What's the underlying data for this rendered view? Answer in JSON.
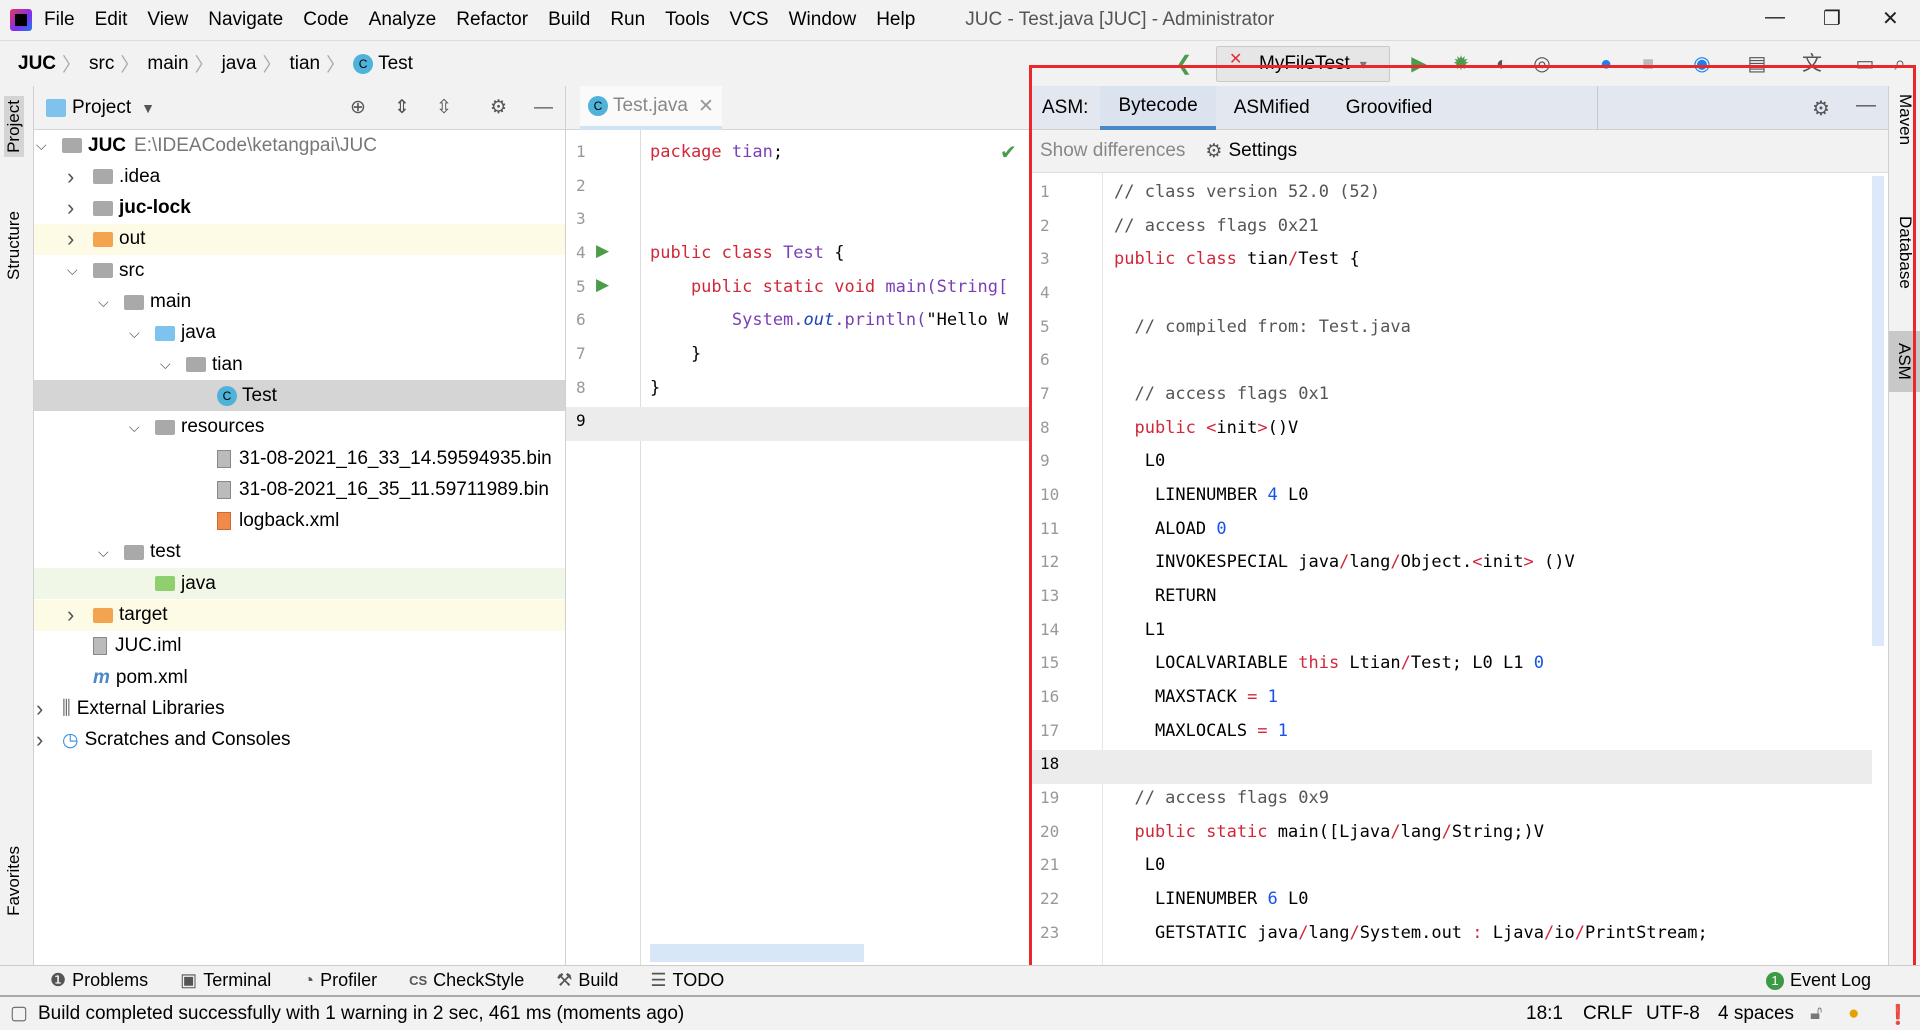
{
  "menu": {
    "items": [
      "File",
      "Edit",
      "View",
      "Navigate",
      "Code",
      "Analyze",
      "Refactor",
      "Build",
      "Run",
      "Tools",
      "VCS",
      "Window",
      "Help"
    ],
    "window_title": "JUC - Test.java [JUC] - Administrator"
  },
  "breadcrumb": [
    "JUC",
    "src",
    "main",
    "java",
    "tian",
    "Test"
  ],
  "toolbar": {
    "run_config": "MyFileTest"
  },
  "left_strip": {
    "project": "Project",
    "structure": "Structure",
    "favorites": "Favorites"
  },
  "right_strip": {
    "maven": "Maven",
    "database": "Database",
    "asm": "ASM"
  },
  "project": {
    "title": "Project",
    "tree": [
      {
        "label": "JUC",
        "extra": "E:\\IDEACode\\ketangpai\\JUC",
        "depth": 0,
        "expanded": true,
        "icon": "module-folder",
        "bold": true
      },
      {
        "label": ".idea",
        "depth": 1,
        "expanded": false,
        "icon": "folder"
      },
      {
        "label": "juc-lock",
        "depth": 1,
        "expanded": false,
        "icon": "module-folder",
        "bold": true
      },
      {
        "label": "out",
        "depth": 1,
        "expanded": false,
        "icon": "folder-orange",
        "highlight": "#fdfbe6"
      },
      {
        "label": "src",
        "depth": 1,
        "expanded": true,
        "icon": "folder"
      },
      {
        "label": "main",
        "depth": 2,
        "expanded": true,
        "icon": "folder"
      },
      {
        "label": "java",
        "depth": 3,
        "expanded": true,
        "icon": "folder-blue"
      },
      {
        "label": "tian",
        "depth": 4,
        "expanded": true,
        "icon": "package"
      },
      {
        "label": "Test",
        "depth": 5,
        "icon": "java-class",
        "selected": true
      },
      {
        "label": "resources",
        "depth": 3,
        "expanded": true,
        "icon": "resources-folder"
      },
      {
        "label": "31-08-2021_16_33_14.59594935.bin",
        "depth": 5,
        "icon": "file"
      },
      {
        "label": "31-08-2021_16_35_11.59711989.bin",
        "depth": 5,
        "icon": "file"
      },
      {
        "label": "logback.xml",
        "depth": 5,
        "icon": "xml-file"
      },
      {
        "label": "test",
        "depth": 2,
        "expanded": true,
        "icon": "folder"
      },
      {
        "label": "java",
        "depth": 3,
        "icon": "folder-green",
        "highlight": "#f0f7e6"
      },
      {
        "label": "target",
        "depth": 1,
        "expanded": false,
        "icon": "folder-orange",
        "highlight": "#fdfbe6"
      },
      {
        "label": "JUC.iml",
        "depth": 1,
        "icon": "iml-file"
      },
      {
        "label": "pom.xml",
        "depth": 1,
        "icon": "maven-file"
      },
      {
        "label": "External Libraries",
        "depth": 0,
        "expanded": false,
        "icon": "libraries"
      },
      {
        "label": "Scratches and Consoles",
        "depth": 0,
        "expanded": false,
        "icon": "scratches"
      }
    ]
  },
  "editor": {
    "tab": "Test.java",
    "lines": [
      [
        [
          "package ",
          "kw"
        ],
        [
          "tian",
          "id"
        ],
        [
          ";",
          ""
        ]
      ],
      [],
      [],
      [
        [
          "public class ",
          "kw"
        ],
        [
          "Test",
          "id"
        ],
        [
          " {",
          ""
        ]
      ],
      [
        [
          "    public static void ",
          "kw"
        ],
        [
          "main(String[",
          "id"
        ]
      ],
      [
        [
          "        System.",
          "id"
        ],
        [
          "out",
          "it"
        ],
        [
          ".println(",
          "id"
        ],
        [
          "\"Hello W",
          ""
        ]
      ],
      [
        [
          "    }",
          ""
        ]
      ],
      [
        [
          "}",
          ""
        ]
      ],
      []
    ],
    "run_lines": [
      4,
      5
    ],
    "current_line": 9
  },
  "asm": {
    "label": "ASM:",
    "tabs": [
      "Bytecode",
      "ASMified",
      "Groovified"
    ],
    "active_tab": "Bytecode",
    "show_differences": "Show differences",
    "settings": "Settings",
    "current_line": 18,
    "lines": [
      [
        [
          "// class version 52.0 (52)",
          "cm"
        ]
      ],
      [
        [
          "// access flags 0x21",
          "cm"
        ]
      ],
      [
        [
          "public class ",
          "kw"
        ],
        [
          "tian",
          ""
        ],
        [
          "/",
          "sl"
        ],
        [
          "Test {",
          ""
        ]
      ],
      [],
      [
        [
          "  // compiled from: Test.java",
          "cm"
        ]
      ],
      [],
      [
        [
          "  // access flags 0x1",
          "cm"
        ]
      ],
      [
        [
          "  public ",
          "kw"
        ],
        [
          "<",
          "sl"
        ],
        [
          "init",
          ""
        ],
        [
          ">",
          "sl"
        ],
        [
          "()V",
          ""
        ]
      ],
      [
        [
          "   L0",
          ""
        ]
      ],
      [
        [
          "    LINENUMBER ",
          ""
        ],
        [
          "4",
          "num"
        ],
        [
          " L0",
          ""
        ]
      ],
      [
        [
          "    ALOAD ",
          ""
        ],
        [
          "0",
          "num"
        ]
      ],
      [
        [
          "    INVOKESPECIAL java",
          ""
        ],
        [
          "/",
          "sl"
        ],
        [
          "lang",
          ""
        ],
        [
          "/",
          "sl"
        ],
        [
          "Object.",
          ""
        ],
        [
          "<",
          "sl"
        ],
        [
          "init",
          ""
        ],
        [
          ">",
          "sl"
        ],
        [
          " ()V",
          ""
        ]
      ],
      [
        [
          "    RETURN",
          ""
        ]
      ],
      [
        [
          "   L1",
          ""
        ]
      ],
      [
        [
          "    LOCALVARIABLE ",
          ""
        ],
        [
          "this",
          "kw"
        ],
        [
          " Ltian",
          ""
        ],
        [
          "/",
          "sl"
        ],
        [
          "Test; L0 L1 ",
          ""
        ],
        [
          "0",
          "num"
        ]
      ],
      [
        [
          "    MAXSTACK ",
          ""
        ],
        [
          "=",
          "sl"
        ],
        [
          " ",
          ""
        ],
        [
          "1",
          "num"
        ]
      ],
      [
        [
          "    MAXLOCALS ",
          ""
        ],
        [
          "=",
          "sl"
        ],
        [
          " ",
          ""
        ],
        [
          "1",
          "num"
        ]
      ],
      [],
      [
        [
          "  // access flags 0x9",
          "cm"
        ]
      ],
      [
        [
          "  public static ",
          "kw"
        ],
        [
          "main([Ljava",
          ""
        ],
        [
          "/",
          "sl"
        ],
        [
          "lang",
          ""
        ],
        [
          "/",
          "sl"
        ],
        [
          "String;)V",
          ""
        ]
      ],
      [
        [
          "   L0",
          ""
        ]
      ],
      [
        [
          "    LINENUMBER ",
          ""
        ],
        [
          "6",
          "num"
        ],
        [
          " L0",
          ""
        ]
      ],
      [
        [
          "    GETSTATIC java",
          ""
        ],
        [
          "/",
          "sl"
        ],
        [
          "lang",
          ""
        ],
        [
          "/",
          "sl"
        ],
        [
          "System.out ",
          ""
        ],
        [
          ":",
          "sl"
        ],
        [
          " Ljava",
          ""
        ],
        [
          "/",
          "sl"
        ],
        [
          "io",
          ""
        ],
        [
          "/",
          "sl"
        ],
        [
          "PrintStream;",
          ""
        ]
      ]
    ]
  },
  "bottom_tools": [
    {
      "label": "Problems",
      "icon": "problems-icon",
      "glyph": "❶"
    },
    {
      "label": "Terminal",
      "icon": "terminal-icon",
      "glyph": "▣"
    },
    {
      "label": "Profiler",
      "icon": "profiler-icon",
      "glyph": "◔"
    },
    {
      "label": "CheckStyle",
      "icon": "checkstyle-icon",
      "glyph": "CS"
    },
    {
      "label": "Build",
      "icon": "build-hammer-icon",
      "glyph": "⚒"
    },
    {
      "label": "TODO",
      "icon": "todo-list-icon",
      "glyph": "☰"
    }
  ],
  "event_log": {
    "label": "Event Log",
    "count": "1"
  },
  "status": {
    "message": "Build completed successfully with 1 warning in 2 sec, 461 ms (moments ago)",
    "position": "18:1",
    "line_sep": "CRLF",
    "encoding": "UTF-8",
    "indent": "4 spaces"
  },
  "colors": {
    "accent": "#4a88c7",
    "highlight_box": "#e8282b",
    "keyword": "#d0273a",
    "number": "#1750eb"
  }
}
